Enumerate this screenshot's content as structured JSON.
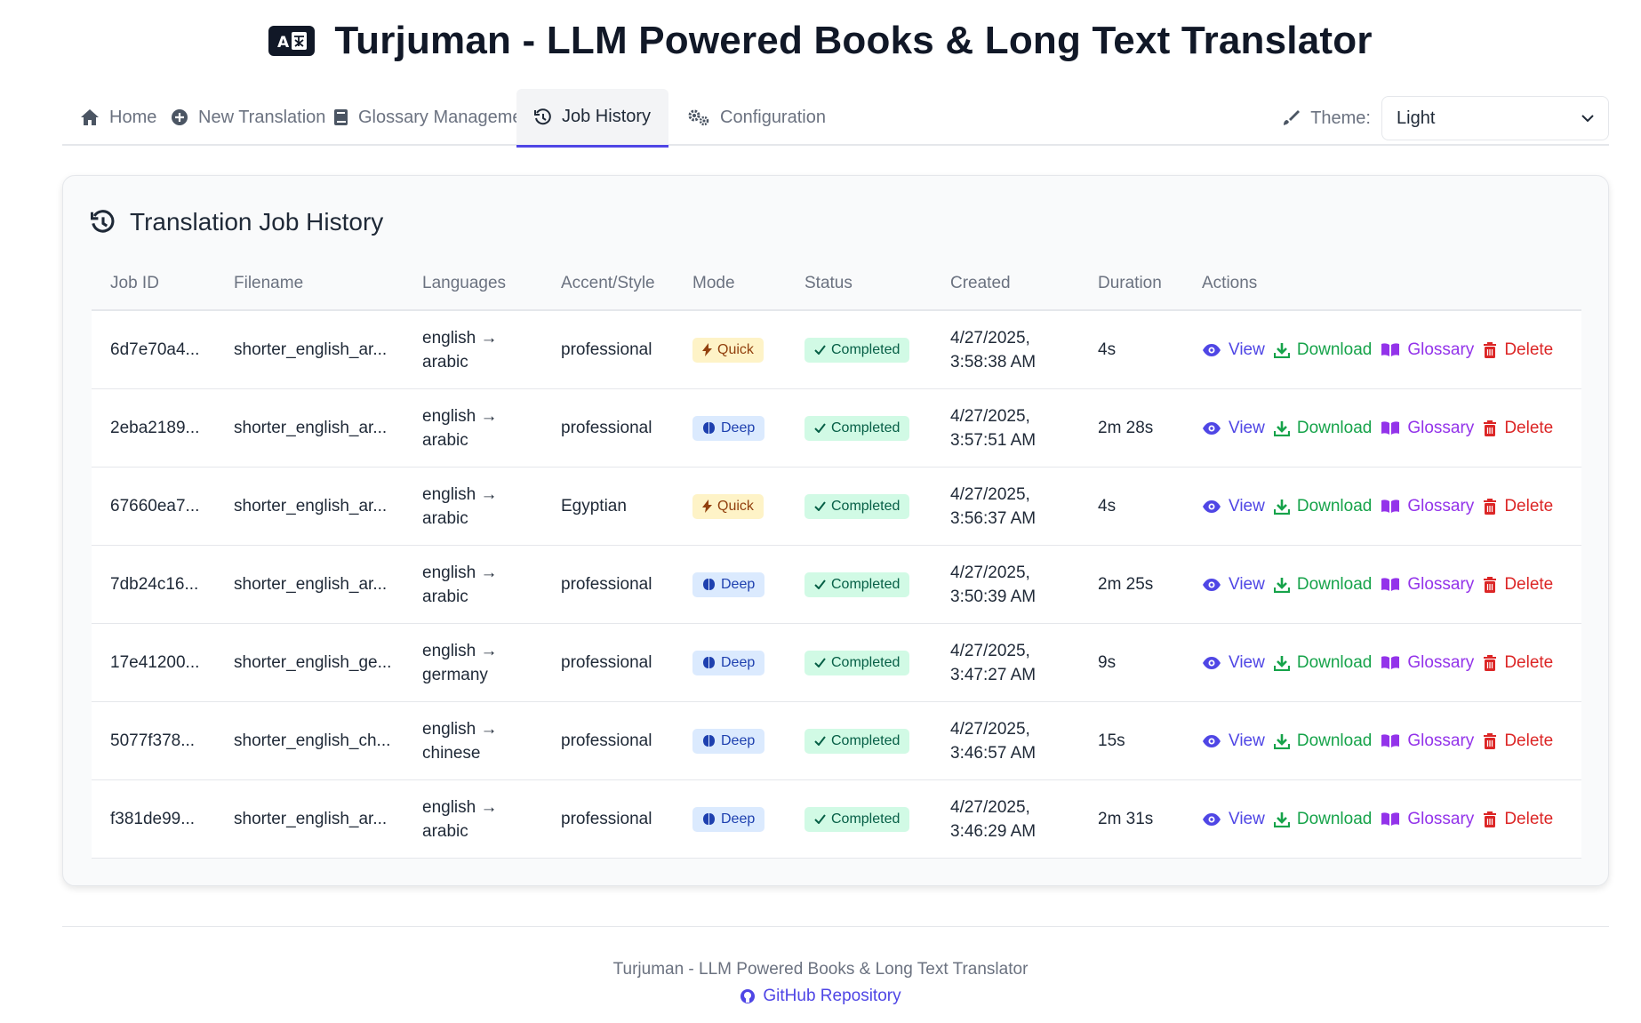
{
  "header": {
    "title": "Turjuman - LLM Powered Books & Long Text Translator",
    "logo_icon": "translate-icon"
  },
  "nav": {
    "tabs": [
      {
        "label": "Home",
        "icon": "home-icon"
      },
      {
        "label": "New Translation",
        "icon": "plus-circle-icon"
      },
      {
        "label": "Glossary Management",
        "icon": "book-icon"
      },
      {
        "label": "Job History",
        "icon": "history-icon",
        "active": true
      },
      {
        "label": "Configuration",
        "icon": "gears-icon"
      }
    ],
    "theme_label": "Theme:",
    "theme_value": "Light"
  },
  "card": {
    "title": "Translation Job History",
    "icon": "history-icon"
  },
  "table": {
    "headers": [
      "Job ID",
      "Filename",
      "Languages",
      "Accent/Style",
      "Mode",
      "Status",
      "Created",
      "Duration",
      "Actions"
    ],
    "rows": [
      {
        "id": "6d7e70a4...",
        "file": "shorter_english_ar...",
        "lang1": "english →",
        "lang2": "arabic",
        "accent": "professional",
        "mode": "Quick",
        "status": "Completed",
        "date": "4/27/2025,",
        "time": "3:58:38 AM",
        "duration": "4s"
      },
      {
        "id": "2eba2189...",
        "file": "shorter_english_ar...",
        "lang1": "english →",
        "lang2": "arabic",
        "accent": "professional",
        "mode": "Deep",
        "status": "Completed",
        "date": "4/27/2025,",
        "time": "3:57:51 AM",
        "duration": "2m 28s"
      },
      {
        "id": "67660ea7...",
        "file": "shorter_english_ar...",
        "lang1": "english →",
        "lang2": "arabic",
        "accent": "Egyptian",
        "mode": "Quick",
        "status": "Completed",
        "date": "4/27/2025,",
        "time": "3:56:37 AM",
        "duration": "4s"
      },
      {
        "id": "7db24c16...",
        "file": "shorter_english_ar...",
        "lang1": "english →",
        "lang2": "arabic",
        "accent": "professional",
        "mode": "Deep",
        "status": "Completed",
        "date": "4/27/2025,",
        "time": "3:50:39 AM",
        "duration": "2m 25s"
      },
      {
        "id": "17e41200...",
        "file": "shorter_english_ge...",
        "lang1": "english →",
        "lang2": "germany",
        "accent": "professional",
        "mode": "Deep",
        "status": "Completed",
        "date": "4/27/2025,",
        "time": "3:47:27 AM",
        "duration": "9s"
      },
      {
        "id": "5077f378...",
        "file": "shorter_english_ch...",
        "lang1": "english →",
        "lang2": "chinese",
        "accent": "professional",
        "mode": "Deep",
        "status": "Completed",
        "date": "4/27/2025,",
        "time": "3:46:57 AM",
        "duration": "15s"
      },
      {
        "id": "f381de99...",
        "file": "shorter_english_ar...",
        "lang1": "english →",
        "lang2": "arabic",
        "accent": "professional",
        "mode": "Deep",
        "status": "Completed",
        "date": "4/27/2025,",
        "time": "3:46:29 AM",
        "duration": "2m 31s"
      }
    ],
    "actions": {
      "view": "View",
      "download": "Download",
      "glossary": "Glossary",
      "delete": "Delete"
    }
  },
  "footer": {
    "text": "Turjuman - LLM Powered Books & Long Text Translator",
    "link": "GitHub Repository"
  },
  "colors": {
    "accent": "#4f46e5",
    "download": "#16a34a",
    "glossary": "#9333ea",
    "delete": "#dc2626"
  }
}
